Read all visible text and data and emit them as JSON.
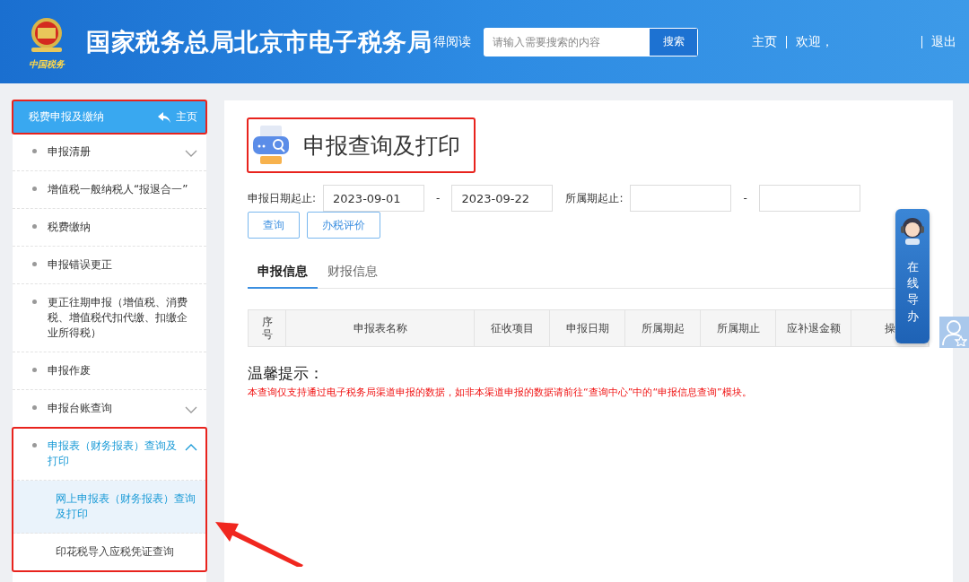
{
  "header": {
    "logo_text": "中国税务",
    "title": "国家税务总局北京市电子税务局",
    "overlay_link": "得阅读",
    "search": {
      "placeholder": "请输入需要搜索的内容",
      "button": "搜索"
    },
    "nav": [
      {
        "kind": "link",
        "label": "主页"
      },
      {
        "kind": "text",
        "label": "欢迎，"
      },
      {
        "kind": "link",
        "label": "退出"
      }
    ]
  },
  "sidebar": {
    "title": "税费申报及缴纳",
    "home": "主页",
    "annotated": true,
    "items": [
      {
        "kind": "group",
        "label": "申报清册",
        "expanded": false,
        "annotated": false
      },
      {
        "kind": "link",
        "label": "增值税一般纳税人“报退合一”"
      },
      {
        "kind": "link",
        "label": "税费缴纳"
      },
      {
        "kind": "link",
        "label": "申报错误更正"
      },
      {
        "kind": "link",
        "label": "更正往期申报（增值税、消费税、增值税代扣代缴、扣缴企业所得税）"
      },
      {
        "kind": "link",
        "label": "申报作废"
      },
      {
        "kind": "group",
        "label": "申报台账查询",
        "expanded": false,
        "annotated": false
      },
      {
        "kind": "group",
        "label": "申报表（财务报表）查询及打印",
        "expanded": true,
        "annotated": true,
        "children": [
          {
            "label": "网上申报表（财务报表）查询及打印",
            "selected": true
          },
          {
            "label": "印花税导入应税凭证查询",
            "selected": false
          }
        ]
      }
    ]
  },
  "page": {
    "title": "申报查询及打印",
    "title_annotated": true,
    "filters": [
      {
        "label": "申报日期起止:",
        "from": "2023-09-01",
        "to": "2023-09-22",
        "separator": "-"
      },
      {
        "label": "所属期起止:",
        "separator": "-"
      }
    ],
    "buttons": [
      "查询",
      "办税评价"
    ],
    "tabs": [
      {
        "label": "申报信息",
        "selected": true
      },
      {
        "label": "财报信息",
        "selected": false
      }
    ],
    "table": {
      "columns": [
        "序号",
        "申报表名称",
        "征收项目",
        "申报日期",
        "所属期起",
        "所属期止",
        "应补退金额",
        "操"
      ]
    },
    "notice": {
      "title": "温馨提示：",
      "text": "本查询仅支持通过电子税务局渠道申报的数据，如非本渠道申报的数据请前往“查询中心”中的“申报信息查询”模块。"
    }
  },
  "guide": {
    "label": "在线导办"
  }
}
